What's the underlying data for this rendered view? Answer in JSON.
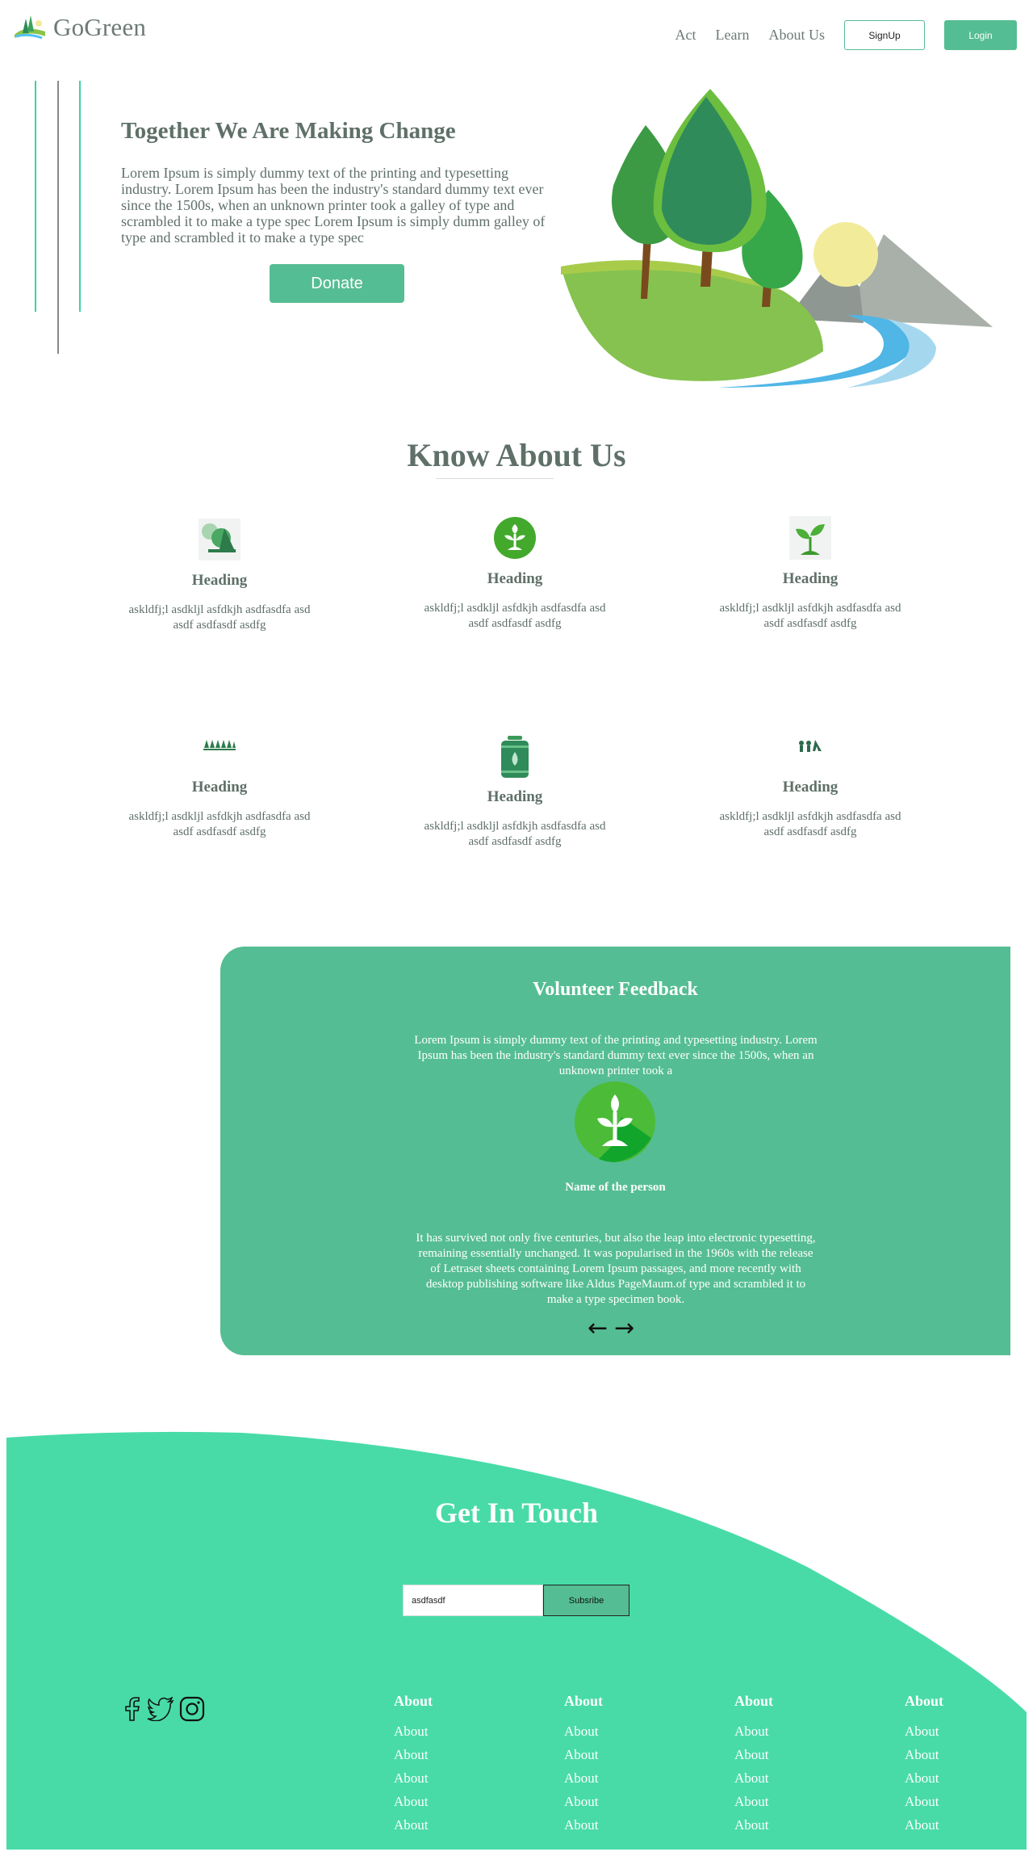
{
  "brand": {
    "name": "GoGreen"
  },
  "nav": {
    "links": [
      "Act",
      "Learn",
      "About Us"
    ],
    "signup_label": "SignUp",
    "login_label": "Login"
  },
  "hero": {
    "title": "Together We Are Making Change",
    "text": "Lorem Ipsum is simply dummy text of the printing and typesetting industry. Lorem Ipsum has been the industry's standard dummy text ever since the 1500s, when an unknown printer took a galley of type and scrambled it to make a type spec Lorem Ipsum is simply dumm galley of type and scrambled it to make a type spec",
    "donate_label": "Donate"
  },
  "about": {
    "title": "Know About Us",
    "features": [
      {
        "icon": "trees-icon",
        "heading": "Heading",
        "text": "askldfj;l asdkljl asfdkjh asdfasdfa asd asdf asdfasdf asdfg"
      },
      {
        "icon": "plant-circle-icon",
        "heading": "Heading",
        "text": "askldfj;l asdkljl asfdkjh asdfasdfa asd asdf asdfasdf asdfg"
      },
      {
        "icon": "sprout-icon",
        "heading": "Heading",
        "text": "askldfj;l asdkljl asfdkjh asdfasdfa asd asdf asdfasdf asdfg"
      },
      {
        "icon": "forest-row-icon",
        "heading": "Heading",
        "text": "askldfj;l asdkljl asfdkjh asdfasdfa asd asdf asdfasdf asdfg"
      },
      {
        "icon": "water-barrel-icon",
        "heading": "Heading",
        "text": "askldfj;l asdkljl asfdkjh asdfasdfa asd asdf asdfasdf asdfg"
      },
      {
        "icon": "people-planting-icon",
        "heading": "Heading",
        "text": "askldfj;l asdkljl asfdkjh asdfasdfa asd asdf asdfasdf asdfg"
      }
    ]
  },
  "feedback": {
    "title": "Volunteer Feedback",
    "text1": "Lorem Ipsum is simply dummy text of the printing and typesetting industry. Lorem Ipsum has been the industry's standard dummy text ever since the 1500s, when an unknown printer took a",
    "name": "Name of the person",
    "text2": "It has survived not only five centuries, but also the leap into electronic typesetting, remaining essentially unchanged. It was popularised in the 1960s with the release of Letraset sheets containing Lorem Ipsum passages, and more recently with desktop publishing software like Aldus PageMaum.of type and scrambled it to make a type specimen book.",
    "prev_arrow": "←",
    "next_arrow": "→"
  },
  "contact": {
    "title": "Get In Touch",
    "input_value": "asdfasdf",
    "subscribe_label": "Subsribe"
  },
  "footer": {
    "socials": [
      "facebook-icon",
      "twitter-icon",
      "instagram-icon"
    ],
    "columns": [
      {
        "heading": "About",
        "links": [
          "About",
          "About",
          "About",
          "About",
          "About"
        ]
      },
      {
        "heading": "About",
        "links": [
          "About",
          "About",
          "About",
          "About",
          "About"
        ]
      },
      {
        "heading": "About",
        "links": [
          "About",
          "About",
          "About",
          "About",
          "About"
        ]
      },
      {
        "heading": "About",
        "links": [
          "About",
          "About",
          "About",
          "About",
          "About"
        ]
      }
    ]
  },
  "colors": {
    "accent": "#55bd93",
    "contact_bg": "#48dba8",
    "text": "#5f7068",
    "line_teal": "#3fd0a8"
  }
}
